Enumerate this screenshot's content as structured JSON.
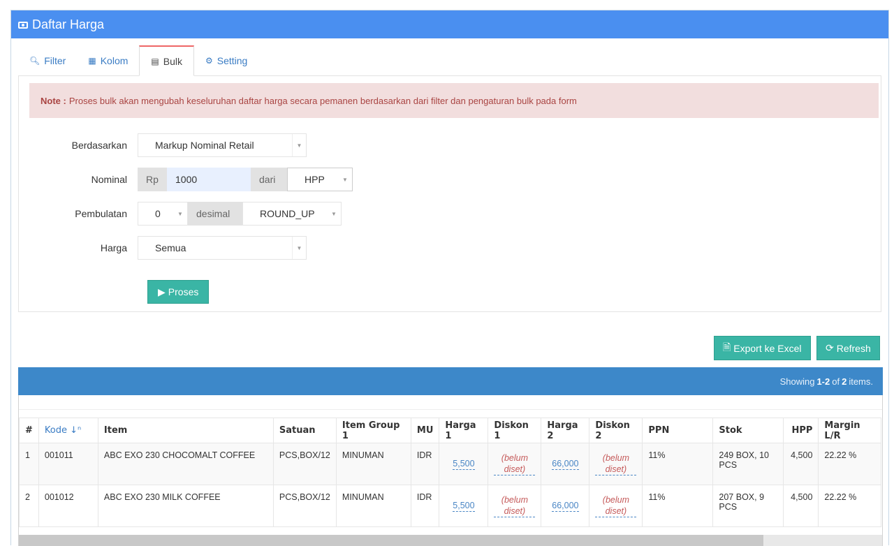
{
  "panel": {
    "title": "Daftar Harga",
    "title_icon": "money-icon"
  },
  "tabs": [
    {
      "label": "Filter",
      "icon": "search-icon",
      "active": false
    },
    {
      "label": "Kolom",
      "icon": "table-icon",
      "active": false
    },
    {
      "label": "Bulk",
      "icon": "window-icon",
      "active": true
    },
    {
      "label": "Setting",
      "icon": "cogs-icon",
      "active": false
    }
  ],
  "alert": {
    "label": "Note :",
    "text": "Proses bulk akan mengubah keseluruhan daftar harga secara pemanen berdasarkan dari filter dan pengaturan bulk pada form"
  },
  "form": {
    "berdasarkan": {
      "label": "Berdasarkan",
      "value": "Markup Nominal Retail"
    },
    "nominal": {
      "label": "Nominal",
      "prefix": "Rp",
      "value": "1000",
      "mid_addon": "dari",
      "dari_value": "HPP"
    },
    "pembulatan": {
      "label": "Pembulatan",
      "value": "0",
      "addon": "desimal",
      "mode": "ROUND_UP"
    },
    "harga": {
      "label": "Harga",
      "value": "Semua"
    },
    "submit_label": "Proses"
  },
  "toolbar": {
    "export_label": "Export ke Excel",
    "refresh_label": "Refresh"
  },
  "summary": {
    "prefix": "Showing",
    "range": "1-2",
    "of": "of",
    "total": "2",
    "suffix": "items."
  },
  "table": {
    "headers": [
      "#",
      "Kode",
      "Item",
      "Satuan",
      "Item Group 1",
      "MU",
      "Harga 1",
      "Diskon 1",
      "Harga 2",
      "Diskon 2",
      "PPN",
      "Stok",
      "HPP",
      "Margin L/R"
    ],
    "rows": [
      {
        "no": "1",
        "kode": "001011",
        "item": "ABC EXO 230 CHOCOMALT COFFEE",
        "satuan": "PCS,BOX/12",
        "group": "MINUMAN",
        "mu": "IDR",
        "harga1": "5,500",
        "diskon1": "(belum diset)",
        "harga2": "66,000",
        "diskon2": "(belum diset)",
        "ppn": "11%",
        "stok": "249 BOX, 10 PCS",
        "hpp": "4,500",
        "margin": "22.22 %"
      },
      {
        "no": "2",
        "kode": "001012",
        "item": "ABC EXO 230 MILK COFFEE",
        "satuan": "PCS,BOX/12",
        "group": "MINUMAN",
        "mu": "IDR",
        "harga1": "5,500",
        "diskon1": "(belum diset)",
        "harga2": "66,000",
        "diskon2": "(belum diset)",
        "ppn": "11%",
        "stok": "207 BOX, 9 PCS",
        "hpp": "4,500",
        "margin": "22.22 %"
      }
    ]
  }
}
